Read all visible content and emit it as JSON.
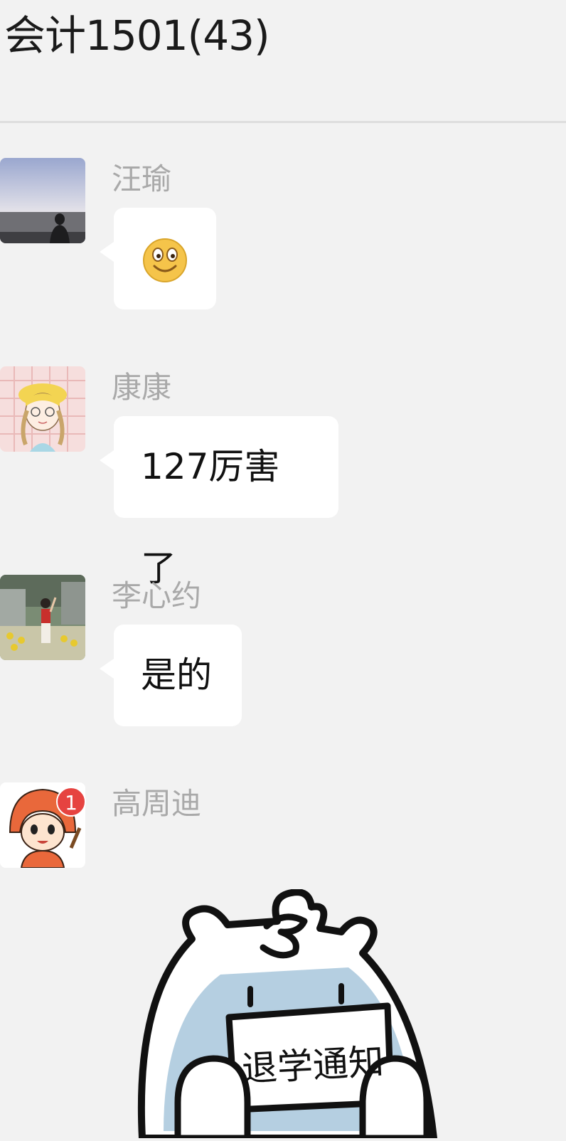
{
  "header": {
    "title": "会计1501(43)"
  },
  "messages": [
    {
      "sender": "汪瑜",
      "type": "emoji",
      "emoji": "smiley-face-icon"
    },
    {
      "sender": "康康",
      "type": "text",
      "text": "127厉害了"
    },
    {
      "sender": "李心约",
      "type": "text",
      "text": "是的"
    },
    {
      "sender": "高周迪",
      "type": "sticker",
      "badge": "1",
      "sticker_text": "退学通知"
    }
  ]
}
